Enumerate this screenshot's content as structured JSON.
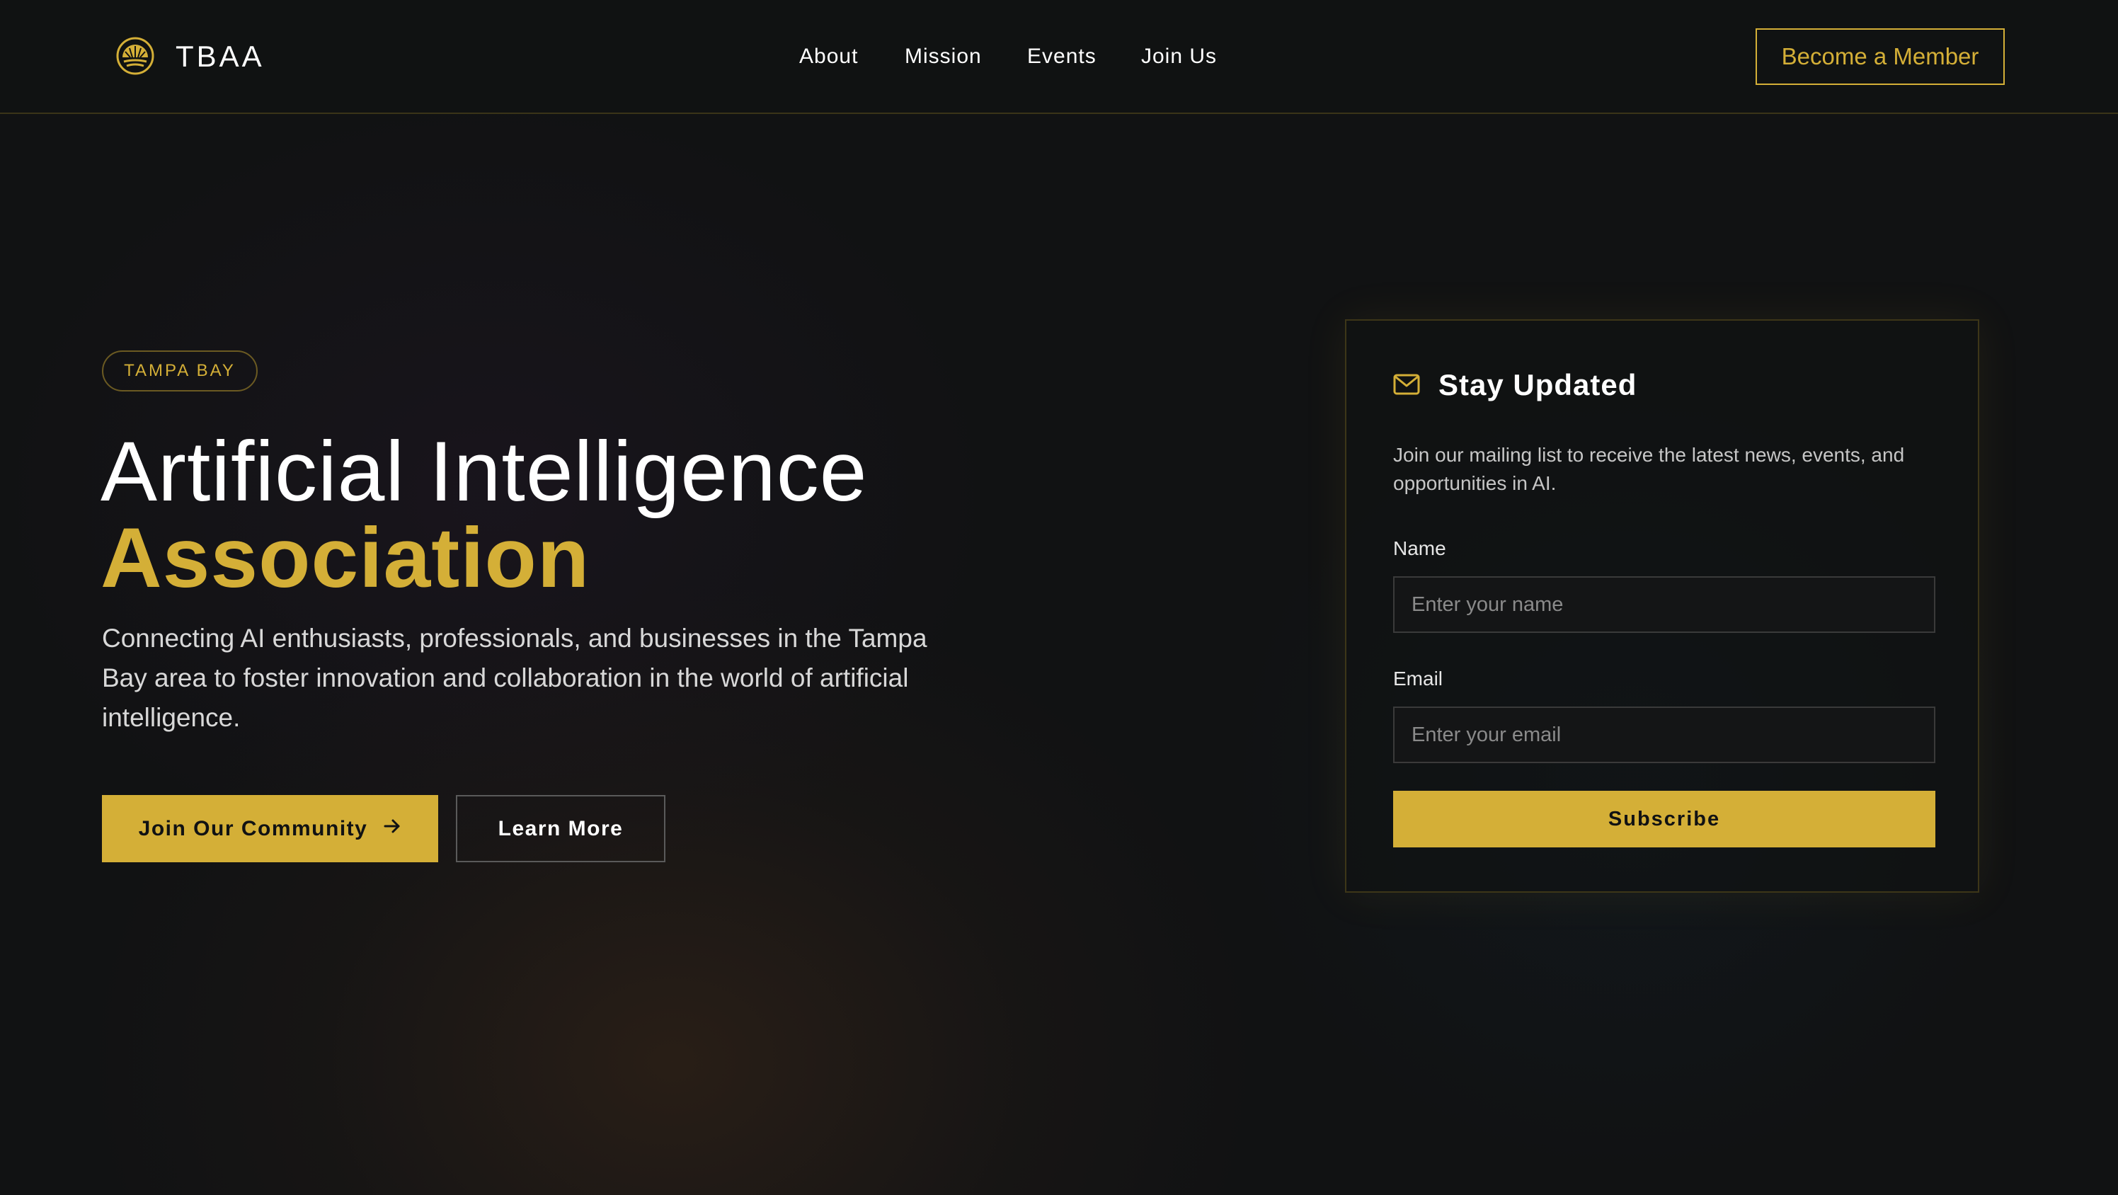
{
  "brand": {
    "name": "TBAA",
    "logo_icon": "sunrise-emblem-icon"
  },
  "nav": {
    "links": [
      {
        "label": "About"
      },
      {
        "label": "Mission"
      },
      {
        "label": "Events"
      },
      {
        "label": "Join Us"
      }
    ],
    "cta_label": "Become a Member"
  },
  "hero": {
    "badge": "TAMPA BAY",
    "title_line1": "Artificial Intelligence",
    "title_line2": "Association",
    "description": "Connecting AI enthusiasts, professionals, and businesses in the Tampa Bay area to foster innovation and collaboration in the world of artificial intelligence.",
    "primary_button": "Join Our Community",
    "primary_button_icon": "arrow-right-icon",
    "secondary_button": "Learn More"
  },
  "newsletter": {
    "icon": "mail-icon",
    "title": "Stay Updated",
    "description": "Join our mailing list to receive the latest news, events, and opportunities in AI.",
    "name_label": "Name",
    "name_placeholder": "Enter your name",
    "email_label": "Email",
    "email_placeholder": "Enter your email",
    "submit_label": "Subscribe"
  },
  "colors": {
    "accent": "#d4af37",
    "background": "#111213",
    "text": "#ffffff"
  }
}
